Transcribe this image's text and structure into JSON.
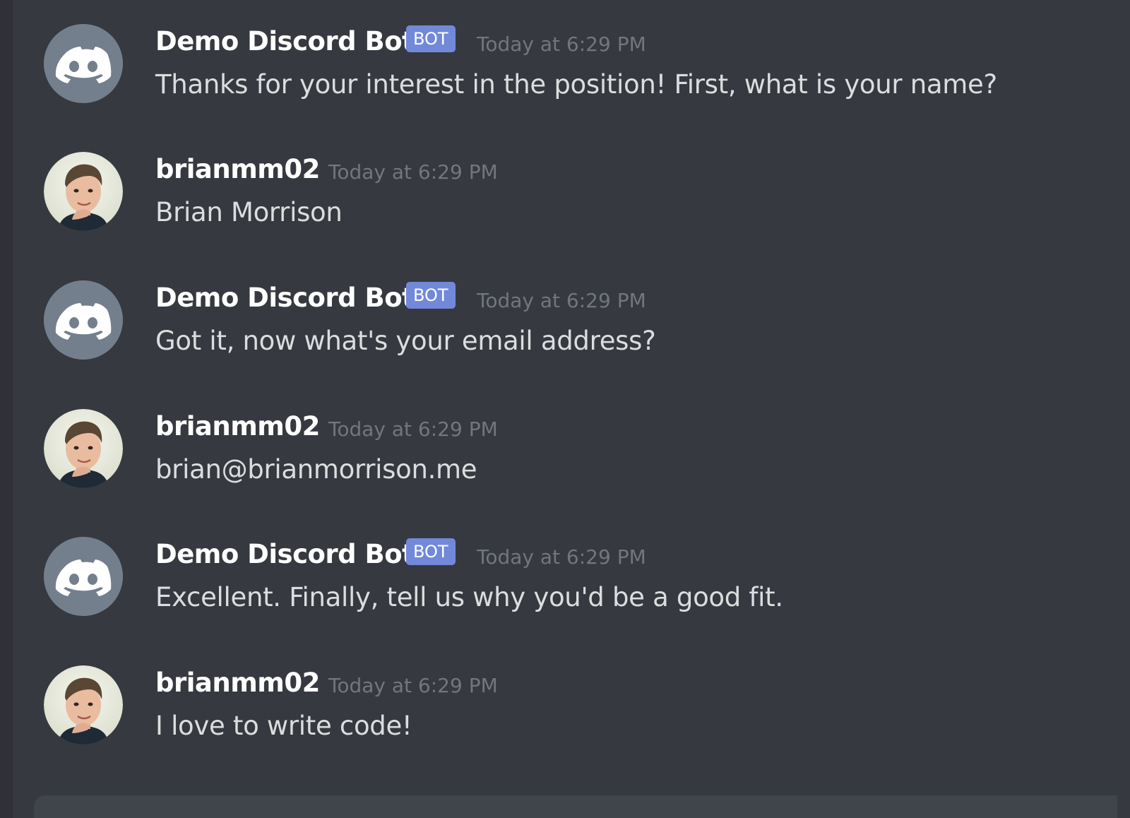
{
  "colors": {
    "background": "#36393f",
    "sidebar": "#2f3136",
    "username": "#ffffff",
    "text": "#dcddde",
    "timestamp": "#72767d",
    "bot_badge": "#7289da",
    "bot_avatar": "#747f8d",
    "composer": "#40444b"
  },
  "messages": [
    {
      "author": "Demo Discord Bot",
      "badge": "BOT",
      "timestamp": "Today at 6:29 PM",
      "content": "Thanks for your interest in the position! First, what is your name?",
      "avatar_icon": "discord-logo-icon"
    },
    {
      "author": "brianmm02",
      "timestamp": "Today at 6:29 PM",
      "content": "Brian Morrison",
      "avatar_icon": "user-photo"
    },
    {
      "author": "Demo Discord Bot",
      "badge": "BOT",
      "timestamp": "Today at 6:29 PM",
      "content": "Got it, now what's your email address?",
      "avatar_icon": "discord-logo-icon"
    },
    {
      "author": "brianmm02",
      "timestamp": "Today at 6:29 PM",
      "content": "brian@brianmorrison.me",
      "avatar_icon": "user-photo"
    },
    {
      "author": "Demo Discord Bot",
      "badge": "BOT",
      "timestamp": "Today at 6:29 PM",
      "content": "Excellent. Finally, tell us why you'd be a good fit.",
      "avatar_icon": "discord-logo-icon"
    },
    {
      "author": "brianmm02",
      "timestamp": "Today at 6:29 PM",
      "content": "I love to write code!",
      "avatar_icon": "user-photo"
    }
  ]
}
